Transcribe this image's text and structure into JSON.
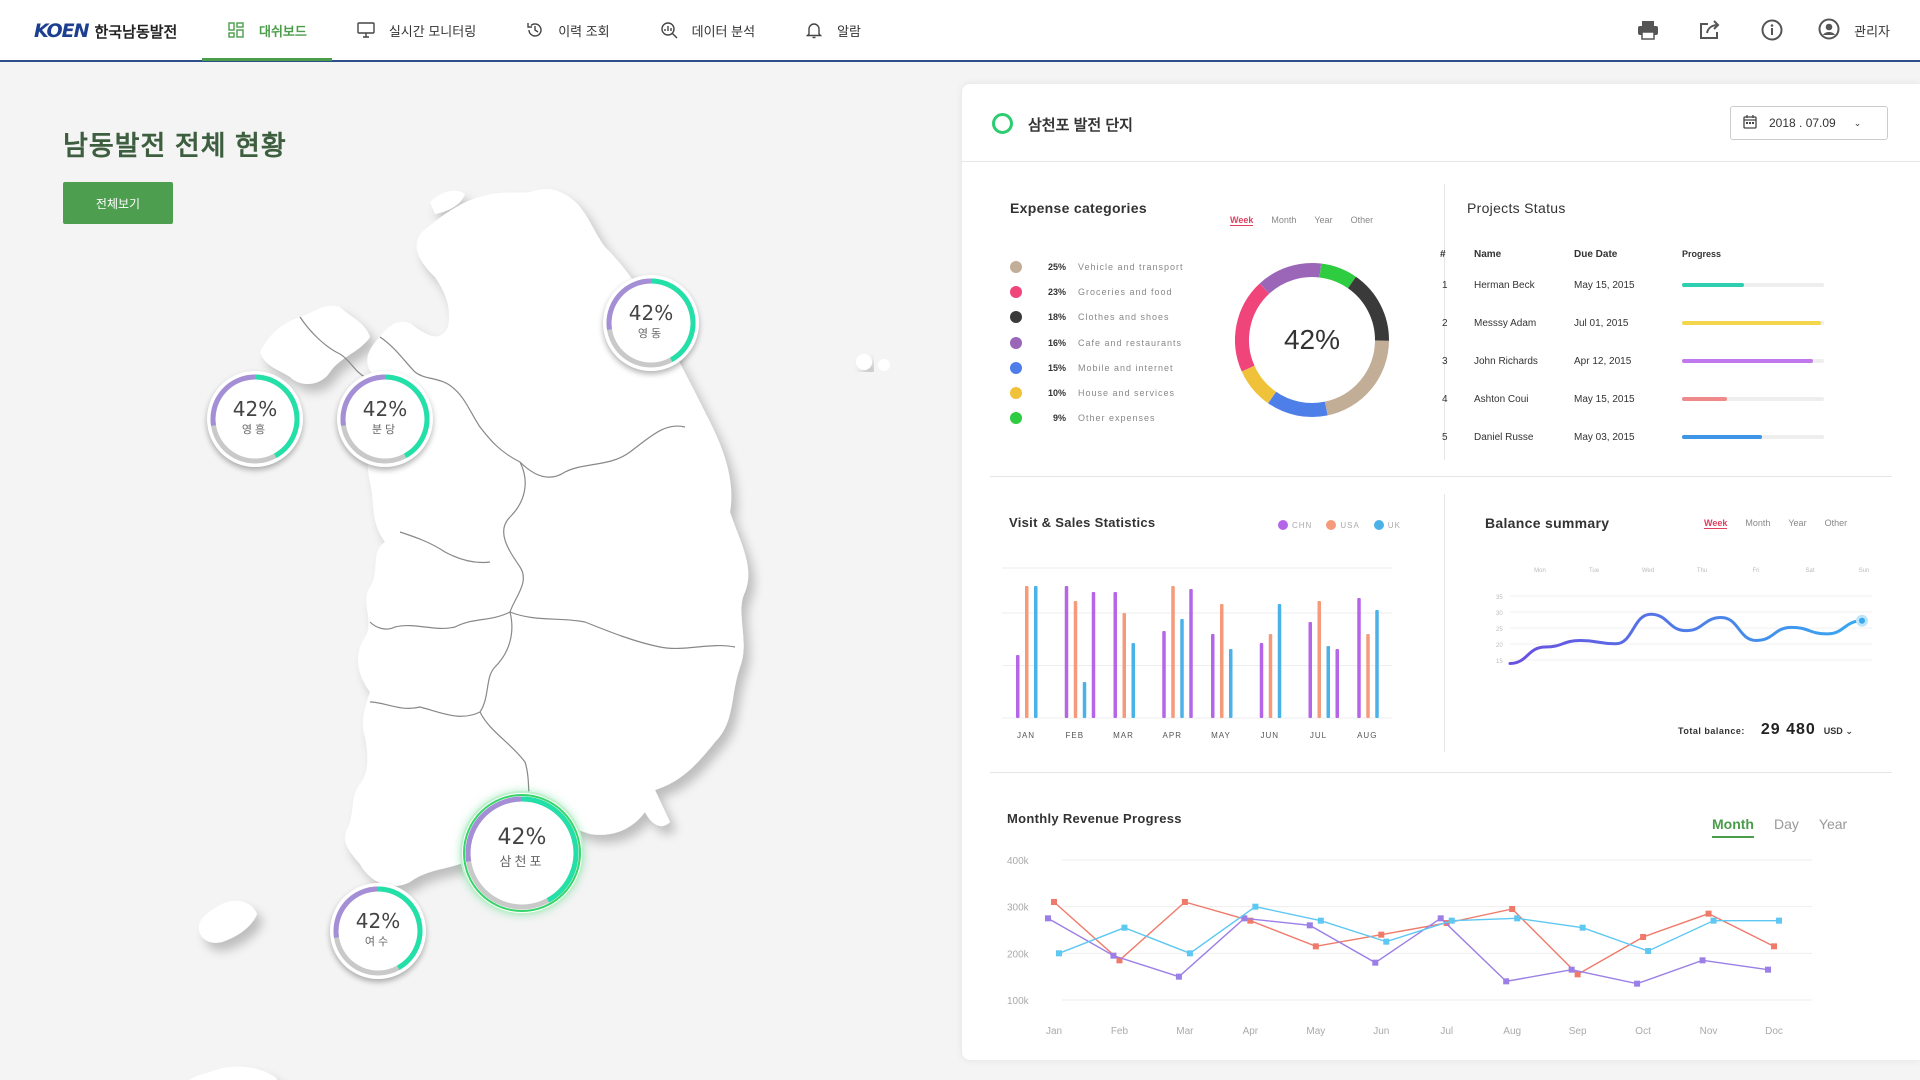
{
  "header": {
    "logo_mark": "KOEN",
    "logo_text": "한국남동발전",
    "nav": [
      {
        "label": "대쉬보드",
        "icon": "dashboard-icon",
        "active": true
      },
      {
        "label": "실시간 모니터링",
        "icon": "monitor-icon",
        "active": false
      },
      {
        "label": "이력 조회",
        "icon": "history-icon",
        "active": false
      },
      {
        "label": "데이터 분석",
        "icon": "analysis-icon",
        "active": false
      },
      {
        "label": "알람",
        "icon": "bell-icon",
        "active": false
      }
    ],
    "tools": [
      "print-icon",
      "share-icon",
      "info-icon"
    ],
    "user_label": "관리자"
  },
  "left": {
    "title": "남동발전 전체 현황",
    "view_all": "전체보기",
    "gauges": [
      {
        "name": "영흥",
        "value": "42%",
        "progress": 0.42
      },
      {
        "name": "분당",
        "value": "42%",
        "progress": 0.42
      },
      {
        "name": "영동",
        "value": "42%",
        "progress": 0.42
      },
      {
        "name": "삼천포",
        "value": "42%",
        "progress": 0.42,
        "highlight": true
      },
      {
        "name": "여수",
        "value": "42%",
        "progress": 0.42
      }
    ]
  },
  "panel": {
    "site_title": "삼천포 발전 단지",
    "date": "2018 . 07.09",
    "expense": {
      "title": "Expense categories",
      "tabs": [
        "Week",
        "Month",
        "Year",
        "Other"
      ],
      "active_tab": "Week",
      "center_value": "42%",
      "items": [
        {
          "pct": "25%",
          "label": "Vehicle and transport",
          "color": "#c2ad97",
          "value": 25
        },
        {
          "pct": "23%",
          "label": "Groceries and food",
          "color": "#f0457a",
          "value": 23
        },
        {
          "pct": "18%",
          "label": "Clothes and shoes",
          "color": "#3a3a3a",
          "value": 18
        },
        {
          "pct": "16%",
          "label": "Cafe and restaurants",
          "color": "#9b66b8",
          "value": 16
        },
        {
          "pct": "15%",
          "label": "Mobile and internet",
          "color": "#4e7ee8",
          "value": 15
        },
        {
          "pct": "10%",
          "label": "House and services",
          "color": "#f0c23a",
          "value": 10
        },
        {
          "pct": "9%",
          "label": "Other expenses",
          "color": "#2ecc40",
          "value": 9
        }
      ]
    },
    "projects": {
      "title": "Projects Status",
      "headers": [
        "#",
        "Name",
        "Due Date",
        "Progress"
      ],
      "rows": [
        {
          "no": "1",
          "name": "Herman Beck",
          "date": "May 15, 2015",
          "progress": 0.44,
          "color": "#2ecfb0"
        },
        {
          "no": "2",
          "name": "Messsy Adam",
          "date": "Jul 01, 2015",
          "progress": 0.98,
          "color": "#f3d54e"
        },
        {
          "no": "3",
          "name": "John Richards",
          "date": "Apr 12, 2015",
          "progress": 0.92,
          "color": "#c078ee"
        },
        {
          "no": "4",
          "name": "Ashton Coui",
          "date": "May 15, 2015",
          "progress": 0.32,
          "color": "#f08a8a"
        },
        {
          "no": "5",
          "name": "Daniel Russe",
          "date": "May 03, 2015",
          "progress": 0.56,
          "color": "#3e95e6"
        }
      ]
    },
    "visits": {
      "title": "Visit & Sales Statistics",
      "legend": [
        {
          "name": "CHN",
          "color": "#b565e8"
        },
        {
          "name": "USA",
          "color": "#f59a7a"
        },
        {
          "name": "UK",
          "color": "#4ab2e8"
        }
      ]
    },
    "balance": {
      "title": "Balance summary",
      "tabs": [
        "Week",
        "Month",
        "Year",
        "Other"
      ],
      "active_tab": "Week",
      "total_label": "Total balance:",
      "total_value": "29 480",
      "currency": "USD"
    },
    "revenue": {
      "title": "Monthly Revenue Progress",
      "tabs": [
        "Month",
        "Day",
        "Year"
      ],
      "active_tab": "Month"
    }
  },
  "chart_data": [
    {
      "type": "pie",
      "title": "Expense categories",
      "categories": [
        "Vehicle and transport",
        "Groceries and food",
        "Clothes and shoes",
        "Cafe and restaurants",
        "Mobile and internet",
        "House and services",
        "Other expenses"
      ],
      "values": [
        25,
        23,
        18,
        16,
        15,
        10,
        9
      ]
    },
    {
      "type": "bar",
      "title": "Visit & Sales Statistics",
      "categories": [
        "JAN",
        "FEB",
        "MAR",
        "APR",
        "MAY",
        "JUN",
        "JUL",
        "AUG"
      ],
      "series": [
        {
          "name": "CHN",
          "values": [
            42,
            88,
            84,
            58,
            56,
            50,
            64,
            80
          ]
        },
        {
          "name": "USA",
          "values": [
            88,
            78,
            70,
            88,
            76,
            56,
            78,
            56
          ]
        },
        {
          "name": "UK",
          "values": [
            88,
            24,
            50,
            66,
            46,
            76,
            48,
            72
          ]
        }
      ],
      "extra_series": {
        "name": "CHN-2",
        "values": [
          null,
          84,
          null,
          86,
          null,
          null,
          46,
          null
        ]
      },
      "ylim": [
        0,
        100
      ]
    },
    {
      "type": "line",
      "title": "Balance summary",
      "categories": [
        "Mon",
        "Tue",
        "Wed",
        "Thu",
        "Fri",
        "Sat",
        "Sun"
      ],
      "y_ticks": [
        "35",
        "30",
        "25",
        "20",
        "15"
      ],
      "ylim": [
        13,
        38
      ],
      "values": [
        15,
        20,
        22,
        21,
        30,
        25,
        29,
        22,
        26,
        24,
        28
      ]
    },
    {
      "type": "line",
      "title": "Monthly Revenue Progress",
      "categories": [
        "Jan",
        "Feb",
        "Mar",
        "Apr",
        "May",
        "Jun",
        "Jul",
        "Aug",
        "Sep",
        "Oct",
        "Nov",
        "Doc"
      ],
      "y_ticks": [
        "400k",
        "300k",
        "200k",
        "100k"
      ],
      "ylim": [
        100,
        400
      ],
      "series": [
        {
          "name": "A",
          "color": "#f07a6a",
          "values": [
            310,
            185,
            310,
            270,
            215,
            240,
            265,
            295,
            155,
            235,
            285,
            215
          ]
        },
        {
          "name": "B",
          "color": "#9b7fe6",
          "values": [
            275,
            195,
            150,
            275,
            260,
            180,
            275,
            140,
            165,
            135,
            185,
            165
          ]
        },
        {
          "name": "C",
          "color": "#5ec8f2",
          "values": [
            200,
            255,
            200,
            300,
            270,
            225,
            270,
            275,
            255,
            205,
            270,
            270
          ]
        }
      ]
    }
  ]
}
